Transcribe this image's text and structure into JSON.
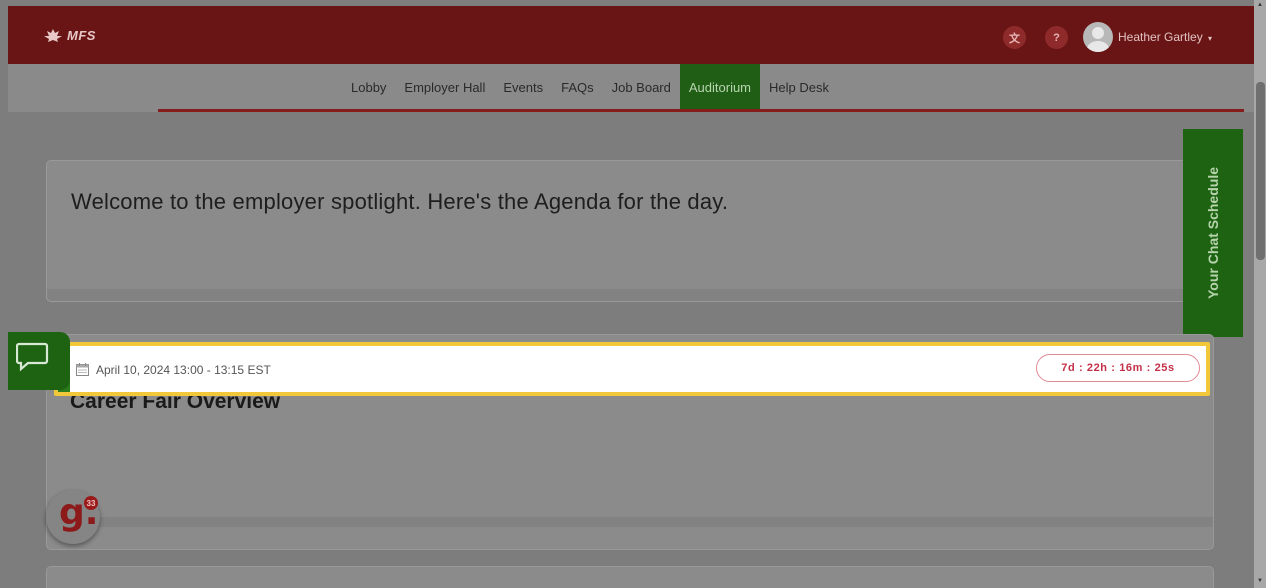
{
  "header": {
    "brand": "MFS",
    "translate_label": "文",
    "help_label": "?",
    "user_name": "Heather Gartley",
    "user_caret": "▾"
  },
  "nav": {
    "items": [
      {
        "label": "Lobby"
      },
      {
        "label": "Employer Hall"
      },
      {
        "label": "Events"
      },
      {
        "label": "FAQs"
      },
      {
        "label": "Job Board"
      },
      {
        "label": "Auditorium",
        "active": true
      },
      {
        "label": "Help Desk"
      }
    ]
  },
  "chat_schedule": {
    "label": "Your Chat Schedule"
  },
  "welcome": {
    "text": "Welcome to the employer spotlight. Here's the Agenda for the day."
  },
  "session": {
    "date": "April 10, 2024 13:00 - 13:15 EST",
    "countdown": "7d : 22h : 16m : 25s",
    "title": "Career Fair Overview"
  },
  "badge": {
    "letter": "g.",
    "count": "33"
  },
  "colors": {
    "header": "#6a1515",
    "active_tab": "#1f5e14",
    "highlight": "#f2c83a",
    "countdown": "#c43048"
  },
  "icons": {
    "logo": "maple-leaf-icon",
    "chat": "chat-bubble-icon",
    "calendar": "calendar-icon"
  }
}
